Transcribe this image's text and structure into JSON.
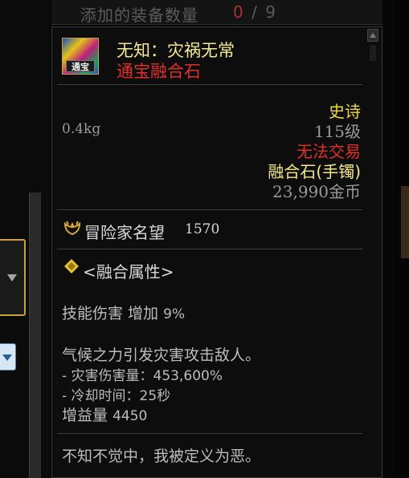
{
  "header": {
    "label": "添加的装备数量",
    "current": "0",
    "separator": " / ",
    "max": "9"
  },
  "item": {
    "name": "无知：灾祸无常",
    "subtitle": "通宝融合石",
    "icon_badge": "通宝",
    "weight": "0.4kg",
    "rarity": "史诗",
    "level": "115级",
    "trade": "无法交易",
    "type": "融合石(手镯)",
    "price": "23,990金币"
  },
  "reputation": {
    "icon": "laurel-icon",
    "label": "冒险家名望",
    "value": "1570"
  },
  "fusion": {
    "icon": "diamond-icon",
    "title": "<融合属性>",
    "skill_damage_label": "技能伤害 增加",
    "skill_damage_value": "9%",
    "effect_line": "气候之力引发灾害攻击敌人。",
    "damage_line": "- 灾害伤害量：453,600%",
    "cooldown_line": "- 冷却时间：25秒",
    "buff_label": "增益量",
    "buff_value": "4450"
  },
  "flavor_text": "不知不觉中，我被定义为恶。",
  "colors": {
    "epic": "#f2d73c",
    "untradable": "#e0302c",
    "item_name": "#f3e98e",
    "border_gold": "#c8a13c"
  }
}
